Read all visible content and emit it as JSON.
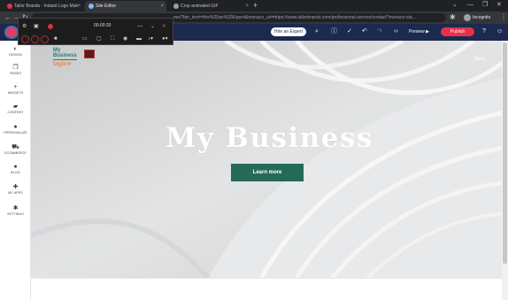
{
  "browser": {
    "tabs": [
      {
        "label": "Tailor Brands - Instant Logo Mak",
        "active": false
      },
      {
        "label": "Site Editor",
        "active": true
      },
      {
        "label": "Crop animated GIF",
        "active": false
      }
    ],
    "url": "me/?btn_text=Hire%20an%20Expert&monaco_url=https://www.tailorbrands.com/professional-service/contact?monaco-cta...",
    "incognito_label": "Incognito"
  },
  "editor": {
    "hire_label": "Hire an Expert",
    "preview_label": "Preview ▶",
    "publish_label": "Publish"
  },
  "recorder": {
    "time": "00:00:20"
  },
  "sidebar": {
    "items": [
      {
        "label": "DESIGN",
        "icon": "palette-icon"
      },
      {
        "label": "PAGES",
        "icon": "pages-icon"
      },
      {
        "label": "WIDGETS",
        "icon": "plus-icon"
      },
      {
        "label": "CONTENT",
        "icon": "folder-icon"
      },
      {
        "label": "PERSONALIZE",
        "icon": "person-icon"
      },
      {
        "label": "ECOMMERCE",
        "icon": "cart-icon"
      },
      {
        "label": "BLOG",
        "icon": "chat-icon"
      },
      {
        "label": "MY APPS",
        "icon": "apps-icon"
      },
      {
        "label": "SETTINGS",
        "icon": "gear-icon"
      }
    ]
  },
  "site": {
    "brand_line1": "My",
    "brand_line2": "Business",
    "brand_tagline": "tagline",
    "menu_label": "Menu",
    "hero_title": "My Business",
    "cta_label": "Learn more"
  },
  "colors": {
    "editor_bar": "#1b2a4e",
    "publish": "#e8304d",
    "cta": "#256a58",
    "brand_green": "#2b7a6a",
    "brand_orange": "#e07a3c"
  }
}
